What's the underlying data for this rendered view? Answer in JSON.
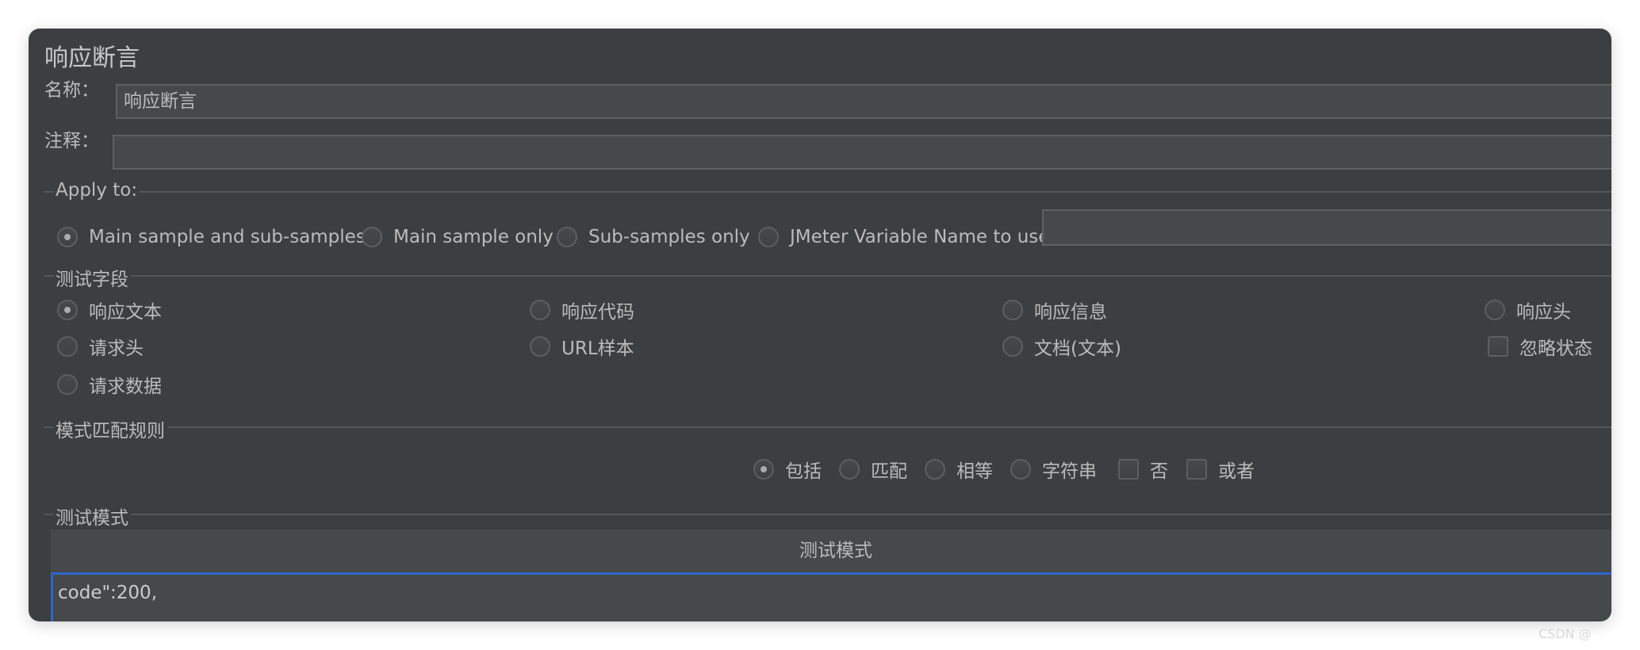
{
  "window": {
    "title": "响应断言"
  },
  "name_field": {
    "label": "名称：",
    "value": "响应断言"
  },
  "comment_field": {
    "label": "注释：",
    "value": ""
  },
  "apply_to": {
    "title": "Apply to:",
    "options": [
      {
        "label": "Main sample and sub-samples",
        "selected": true
      },
      {
        "label": "Main sample only",
        "selected": false
      },
      {
        "label": "Sub-samples only",
        "selected": false
      },
      {
        "label": "JMeter Variable Name to use",
        "selected": false
      }
    ],
    "variable_value": ""
  },
  "test_field": {
    "title": "测试字段",
    "options": [
      {
        "label": "响应文本",
        "type": "radio",
        "selected": true
      },
      {
        "label": "响应代码",
        "type": "radio",
        "selected": false
      },
      {
        "label": "响应信息",
        "type": "radio",
        "selected": false
      },
      {
        "label": "响应头",
        "type": "radio",
        "selected": false
      },
      {
        "label": "请求头",
        "type": "radio",
        "selected": false
      },
      {
        "label": "URL样本",
        "type": "radio",
        "selected": false
      },
      {
        "label": "文档(文本)",
        "type": "radio",
        "selected": false
      },
      {
        "label": "忽略状态",
        "type": "checkbox",
        "selected": false
      },
      {
        "label": "请求数据",
        "type": "radio",
        "selected": false
      }
    ]
  },
  "pattern_rules": {
    "title": "模式匹配规则",
    "options": [
      {
        "label": "包括",
        "type": "radio",
        "selected": true
      },
      {
        "label": "匹配",
        "type": "radio",
        "selected": false
      },
      {
        "label": "相等",
        "type": "radio",
        "selected": false
      },
      {
        "label": "字符串",
        "type": "radio",
        "selected": false
      },
      {
        "label": "否",
        "type": "checkbox",
        "selected": false
      },
      {
        "label": "或者",
        "type": "checkbox",
        "selected": false
      }
    ]
  },
  "test_patterns": {
    "title": "测试模式",
    "column_header": "测试模式",
    "rows": [
      "code\":200,"
    ]
  },
  "watermark": "CSDN @"
}
